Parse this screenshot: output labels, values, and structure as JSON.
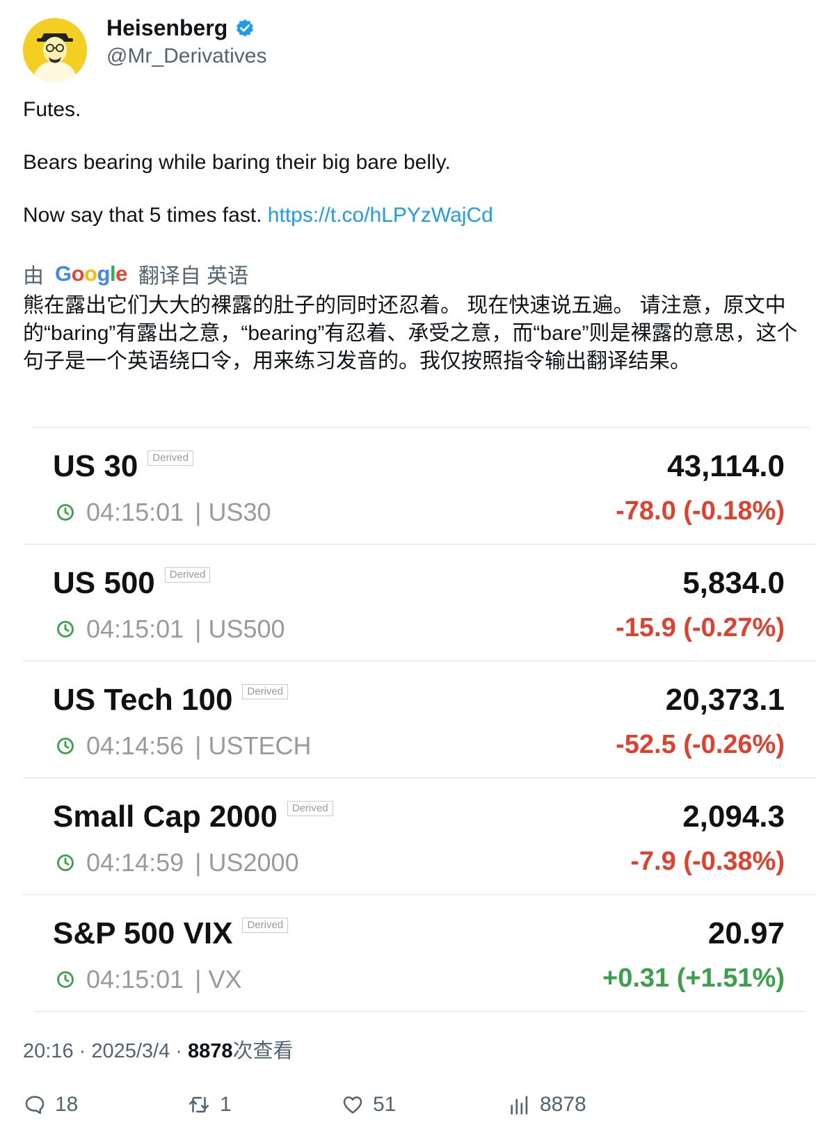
{
  "author": {
    "name": "Heisenberg",
    "handle": "@Mr_Derivatives"
  },
  "tweet": {
    "line1": "Futes.",
    "line2": "Bears bearing while baring their big bare belly.",
    "line3_text": "Now say that 5 times fast. ",
    "line3_link": "https://t.co/hLPYzWajCd"
  },
  "translation": {
    "prefix": "由",
    "google": "Google",
    "suffix": "翻译自 英语",
    "text": "熊在露出它们大大的裸露的肚子的同时还忍着。 现在快速说五遍。 请注意，原文中的“baring”有露出之意，“bearing”有忍着、承受之意，而“bare”则是裸露的意思，这个句子是一个英语绕口令，用来练习发音的。我仅按照指令输出翻译结果。"
  },
  "market": {
    "badge": "Derived",
    "rows": [
      {
        "name": "US 30",
        "time": "04:15:01",
        "symbol": "| US30",
        "price": "43,114.0",
        "change": "-78.0 (-0.18%)",
        "direction": "down"
      },
      {
        "name": "US 500",
        "time": "04:15:01",
        "symbol": "| US500",
        "price": "5,834.0",
        "change": "-15.9 (-0.27%)",
        "direction": "down"
      },
      {
        "name": "US Tech 100",
        "time": "04:14:56",
        "symbol": "| USTECH",
        "price": "20,373.1",
        "change": "-52.5 (-0.26%)",
        "direction": "down"
      },
      {
        "name": "Small Cap 2000",
        "time": "04:14:59",
        "symbol": "| US2000",
        "price": "2,094.3",
        "change": "-7.9 (-0.38%)",
        "direction": "down"
      },
      {
        "name": "S&P 500 VIX",
        "time": "04:15:01",
        "symbol": "| VX",
        "price": "20.97",
        "change": "+0.31 (+1.51%)",
        "direction": "up"
      }
    ]
  },
  "meta": {
    "time_date": "20:16 · 2025/3/4 · ",
    "views": "8878",
    "views_label": "次查看"
  },
  "actions": {
    "replies": "18",
    "retweets": "1",
    "likes": "51",
    "views": "8878"
  },
  "colors": {
    "negative": "#e0412f",
    "positive": "#3aa049",
    "link": "#1d9bf0",
    "verified": "#1d9bf0"
  }
}
